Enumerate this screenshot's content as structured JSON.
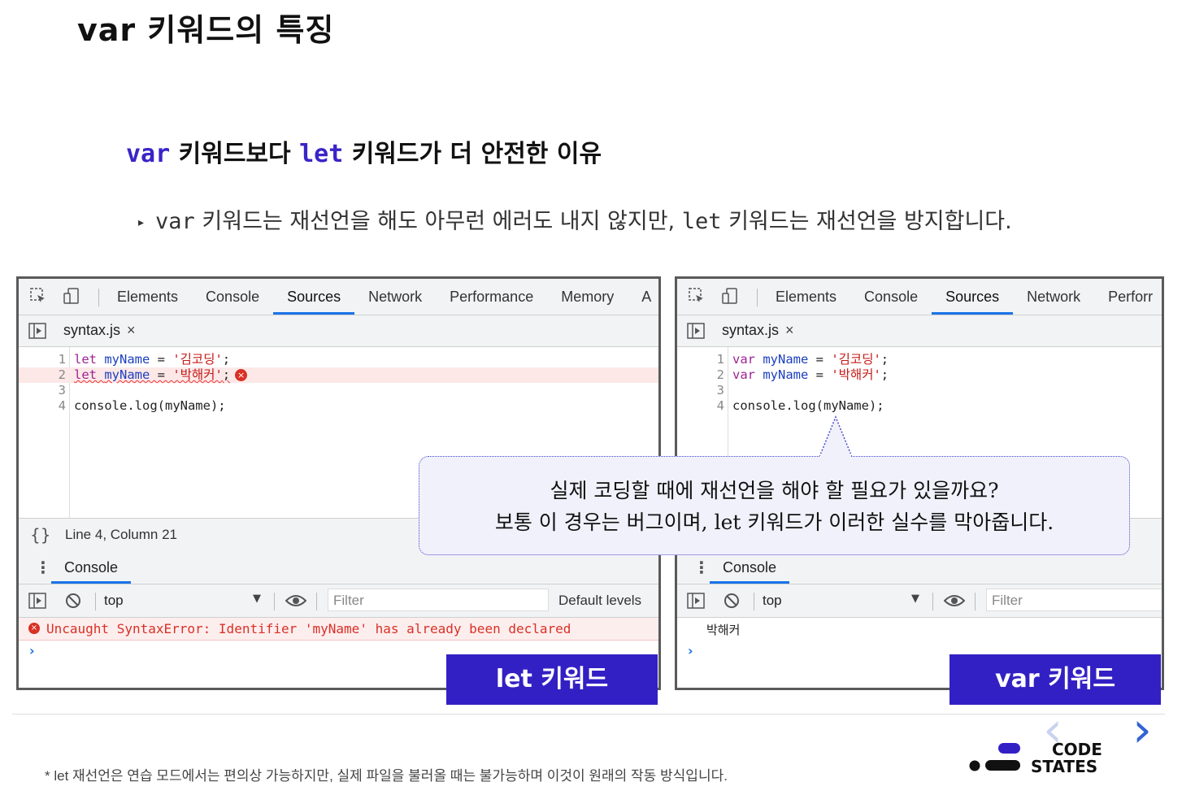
{
  "title": "var 키워드의 특징",
  "subtitle": {
    "kw1": "var",
    "text1": " 키워드보다 ",
    "kw2": "let",
    "text2": " 키워드가 더 안전한 이유"
  },
  "bullet": {
    "marker": "▸",
    "kw1": "var",
    "text1": " 키워드는 재선언을 해도 아무런 에러도 내지 않지만, ",
    "kw2": "let",
    "text2": " 키워드는 재선언을 방지합니다."
  },
  "left_panel": {
    "tabs": [
      "Elements",
      "Console",
      "Sources",
      "Network",
      "Performance",
      "Memory",
      "A"
    ],
    "active_tab": "Sources",
    "file": "syntax.js",
    "close": "×",
    "lines": [
      {
        "num": "1",
        "kw": "let",
        "name": "myName",
        "eq": " = ",
        "str": "'김코딩'",
        "end": ";"
      },
      {
        "num": "2",
        "kw": "let",
        "name": "myName",
        "eq": " = ",
        "str": "'박해커'",
        "end": ";"
      },
      {
        "num": "3",
        "text": ""
      },
      {
        "num": "4",
        "text": "console.log(myName);"
      }
    ],
    "line_error_icon": "×",
    "status_braces": "{}",
    "status": "Line 4, Column 21",
    "drawer_tab": "Console",
    "context": "top",
    "context_arrow": "▼",
    "filter_placeholder": "Filter",
    "levels": "Default levels",
    "console_error_icon": "×",
    "console_error": "Uncaught SyntaxError: Identifier 'myName' has already been declared",
    "prompt": "›",
    "label": "let 키워드"
  },
  "right_panel": {
    "tabs": [
      "Elements",
      "Console",
      "Sources",
      "Network",
      "Perforr"
    ],
    "active_tab": "Sources",
    "file": "syntax.js",
    "close": "×",
    "lines": [
      {
        "num": "1",
        "kw": "var",
        "name": "myName",
        "eq": " = ",
        "str": "'김코딩'",
        "end": ";"
      },
      {
        "num": "2",
        "kw": "var",
        "name": "myName",
        "eq": " = ",
        "str": "'박해커'",
        "end": ";"
      },
      {
        "num": "3",
        "text": ""
      },
      {
        "num": "4",
        "text": "console.log(myName);"
      }
    ],
    "drawer_tab": "Console",
    "context": "top",
    "context_arrow": "▼",
    "filter_placeholder": "Filter",
    "console_log": "박해커",
    "prompt": "›",
    "label": "var 키워드"
  },
  "callout": {
    "line1": "실제 코딩할 때에 재선언을 해야 할 필요가 있을까요?",
    "line2": "보통 이 경우는 버그이며, let 키워드가 이러한 실수를 막아줍니다."
  },
  "footnote": "* let 재선언은 연습 모드에서는 편의상 가능하지만, 실제 파일을 불러올 때는 불가능하며 이것이 원래의 작동 방식입니다.",
  "logo": {
    "line1": "CODE",
    "line2": "STATES"
  },
  "nav": {
    "prev": "‹",
    "next": "›"
  },
  "colors": {
    "accent": "#3320c4",
    "devtools_blue": "#1a73e8",
    "error": "#d93025"
  }
}
